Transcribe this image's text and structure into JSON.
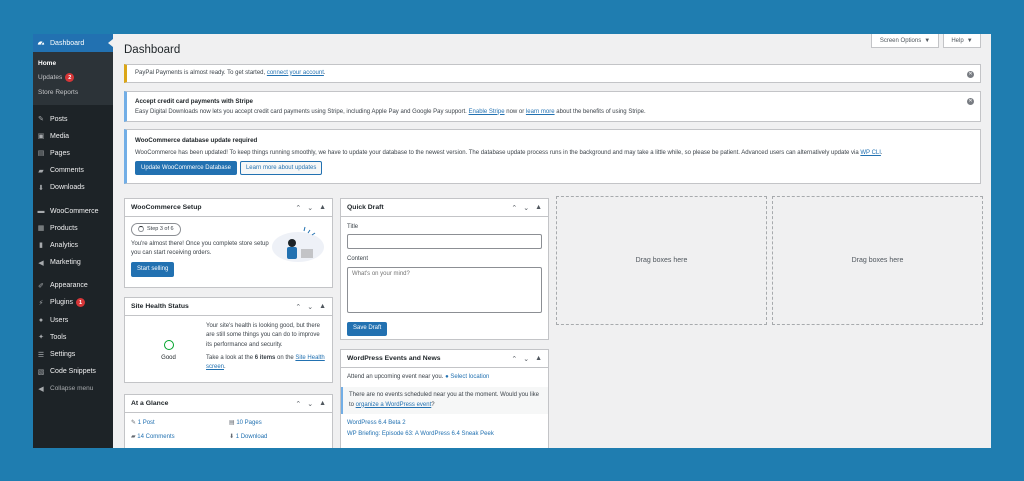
{
  "sidebar": {
    "dashboard": "Dashboard",
    "sub": {
      "home": "Home",
      "updates": "Updates",
      "updates_count": "2",
      "store_reports": "Store Reports"
    },
    "group1": [
      "Posts",
      "Media",
      "Pages",
      "Comments",
      "Downloads"
    ],
    "group2": [
      "WooCommerce",
      "Products",
      "Analytics",
      "Marketing"
    ],
    "group3": {
      "appearance": "Appearance",
      "plugins": "Plugins",
      "plugins_count": "1",
      "users": "Users",
      "tools": "Tools",
      "settings": "Settings",
      "code_snippets": "Code Snippets",
      "collapse": "Collapse menu"
    }
  },
  "header": {
    "title": "Dashboard",
    "screen_options": "Screen Options",
    "help": "Help"
  },
  "notices": {
    "paypal": {
      "text": "PayPal Payments is almost ready. To get started, ",
      "link": "connect your account",
      "end": "."
    },
    "stripe": {
      "title": "Accept credit card payments with Stripe",
      "text": "Easy Digital Downloads now lets you accept credit card payments using Stripe, including Apple Pay and Google Pay support. ",
      "link1": "Enable Stripe",
      "mid": " now or ",
      "link2": "learn more",
      "end": " about the benefits of using Stripe."
    },
    "woo_db": {
      "title": "WooCommerce database update required",
      "text": "WooCommerce has been updated! To keep things running smoothly, we have to update your database to the newest version. The database update process runs in the background and may take a little while, so please be patient. Advanced users can alternatively update via ",
      "link": "WP CLI",
      "end": ".",
      "btn_update": "Update WooCommerce Database",
      "btn_learn": "Learn more about updates"
    }
  },
  "woo_setup": {
    "title": "WooCommerce Setup",
    "step": "Step 3 of 6",
    "text": "You're almost there! Once you complete store setup you can start receiving orders.",
    "btn": "Start selling"
  },
  "site_health": {
    "title": "Site Health Status",
    "status": "Good",
    "text": "Your site's health is looking good, but there are still some things you can do to improve its performance and security.",
    "text2a": "Take a look at the ",
    "text2b": "6 items",
    "text2c": " on the ",
    "link": "Site Health screen",
    "end": "."
  },
  "glance": {
    "title": "At a Glance",
    "posts": "1 Post",
    "pages": "10 Pages",
    "comments": "14 Comments",
    "downloads": "1 Download"
  },
  "quick_draft": {
    "title": "Quick Draft",
    "title_label": "Title",
    "content_label": "Content",
    "content_placeholder": "What's on your mind?",
    "btn": "Save Draft"
  },
  "events": {
    "title": "WordPress Events and News",
    "attend": "Attend an upcoming event near you.",
    "select_location": "Select location",
    "none_a": "There are no events scheduled near you at the moment. Would you like to ",
    "none_link": "organize a WordPress event",
    "none_end": "?",
    "news1": "WordPress 6.4 Beta 2",
    "news2": "WP Briefing: Episode 63: A WordPress 6.4 Sneak Peek"
  },
  "drop_label": "Drag boxes here"
}
